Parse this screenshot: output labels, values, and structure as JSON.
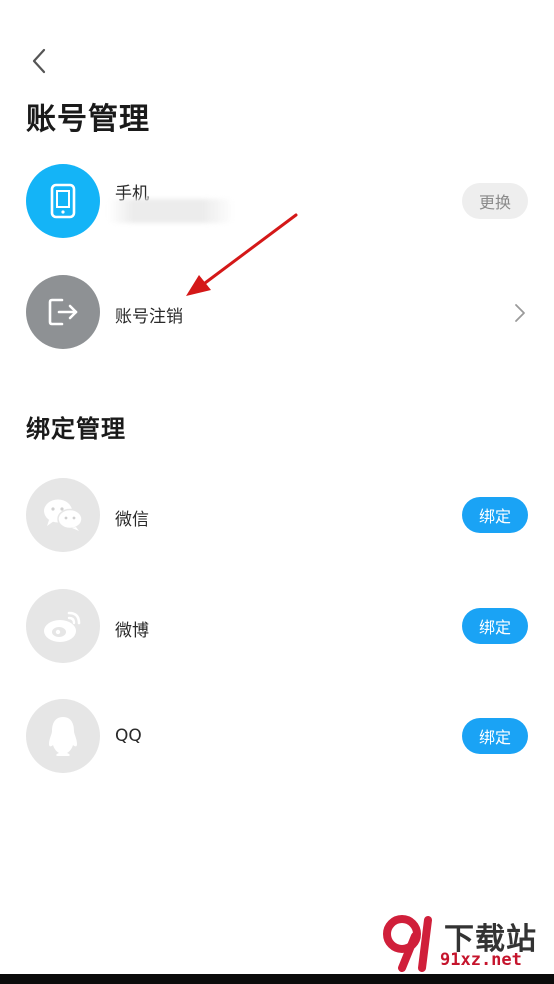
{
  "header": {
    "back_icon": "chevron-left-icon",
    "title": "账号管理"
  },
  "account": {
    "phone": {
      "icon": "phone-icon",
      "label": "手机",
      "action": "更换"
    },
    "deregister": {
      "icon": "logout-icon",
      "label": "账号注销",
      "chevron": "chevron-right-icon"
    }
  },
  "binding": {
    "title": "绑定管理",
    "items": [
      {
        "name": "微信",
        "icon": "wechat-icon",
        "action": "绑定"
      },
      {
        "name": "微博",
        "icon": "weibo-icon",
        "action": "绑定"
      },
      {
        "name": "QQ",
        "icon": "qq-icon",
        "action": "绑定"
      }
    ]
  },
  "watermark": {
    "brand": "下载站",
    "url": "91xz.net"
  },
  "colors": {
    "accent": "#1aa3f5",
    "phone_icon_bg": "#14b4f7",
    "logout_icon_bg": "#8e9194",
    "social_icon_bg": "#e6e6e6"
  }
}
